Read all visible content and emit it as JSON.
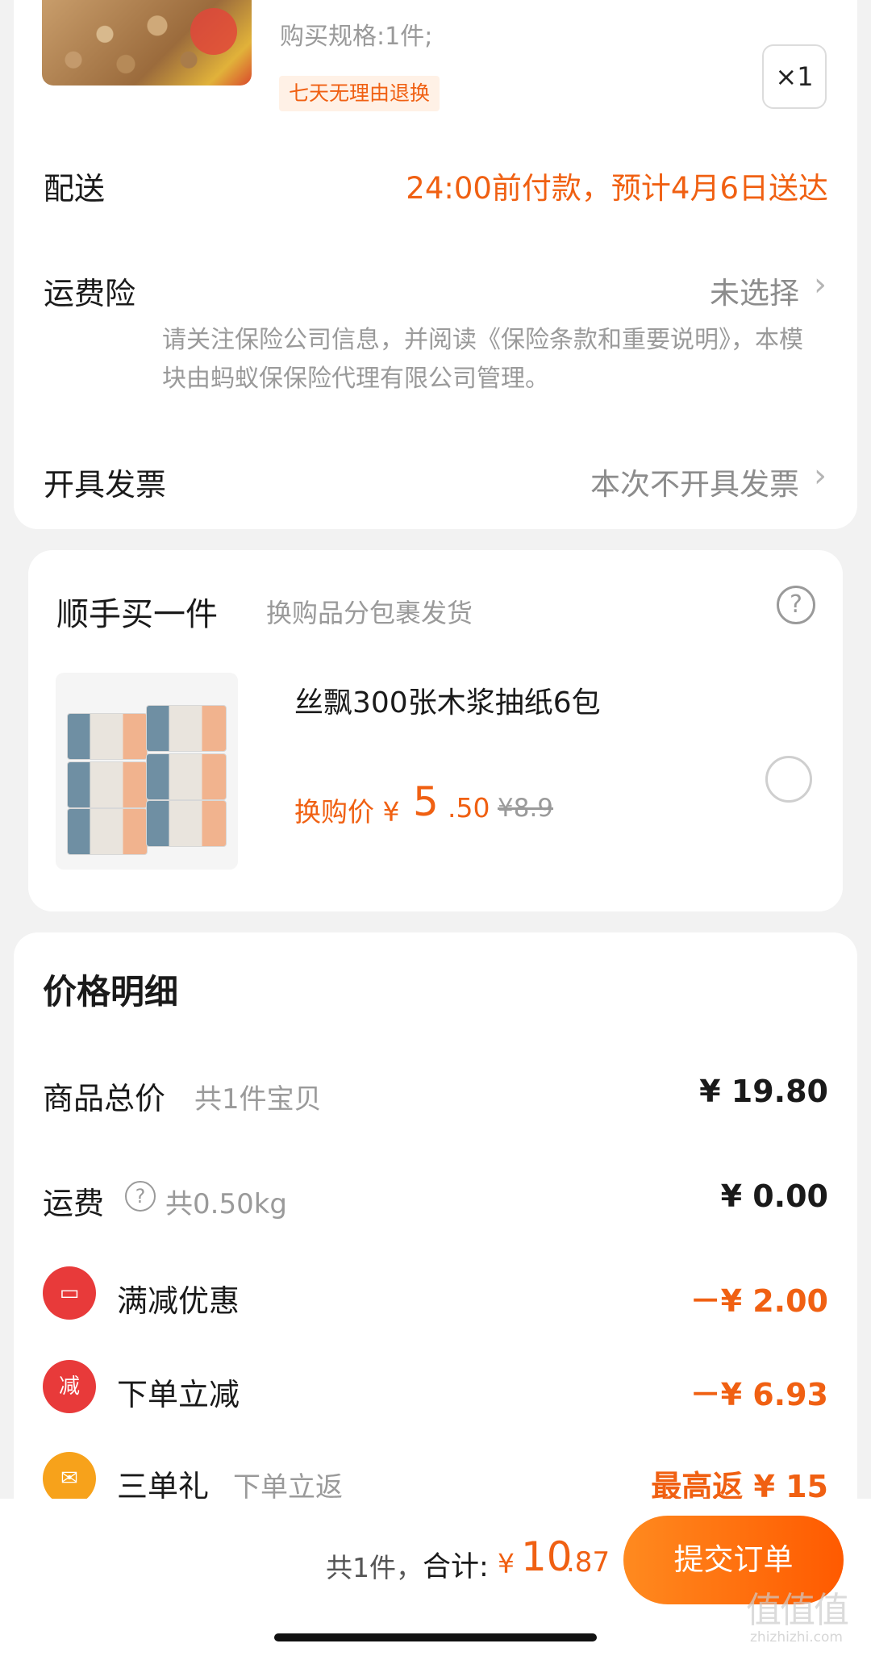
{
  "order": {
    "spec": "购买规格:1件;",
    "return_tag": "七天无理由退换",
    "quantity": "×1",
    "delivery_label": "配送",
    "delivery_value": "24:00前付款，预计4月6日送达",
    "insurance_label": "运费险",
    "insurance_value": "未选择",
    "insurance_note": "请关注保险公司信息，并阅读《保险条款和重要说明》，本模块由蚂蚁保保险代理有限公司管理。",
    "invoice_label": "开具发票",
    "invoice_value": "本次不开具发票"
  },
  "addon": {
    "title": "顺手买一件",
    "subtitle": "换购品分包裹发货",
    "help": "?",
    "product_name": "丝飘300张木浆抽纸6包",
    "price_label": "换购价 ¥",
    "price_int": "5",
    "price_dec": ".50",
    "original_price": "¥8.9",
    "selected": false
  },
  "price_detail": {
    "heading": "价格明细",
    "rows": {
      "goods_label": "商品总价",
      "goods_sub": "共1件宝贝",
      "goods_value": "¥ 19.80",
      "shipping_label": "运费",
      "shipping_sub": "共0.50kg",
      "shipping_value": "¥ 0.00",
      "discount_label": "满减优惠",
      "discount_value": "－¥ 2.00",
      "instant_label": "下单立减",
      "instant_icon_text": "减",
      "instant_value": "－¥ 6.93",
      "gift_label": "三单礼",
      "gift_sub": "下单立返",
      "gift_value": "最高返 ¥ 15"
    }
  },
  "footer": {
    "count": "共1件，",
    "total_label": "合计:",
    "total_yen": "¥",
    "total_int": "10",
    "total_dec": ".87",
    "submit_label": "提交订单"
  },
  "watermark": {
    "main": "值值值",
    "sub": "zhizhizhi.com"
  },
  "colors": {
    "accent": "#f06012",
    "coupon_red": "#e83a3a",
    "gift_orange": "#f7a21b"
  }
}
